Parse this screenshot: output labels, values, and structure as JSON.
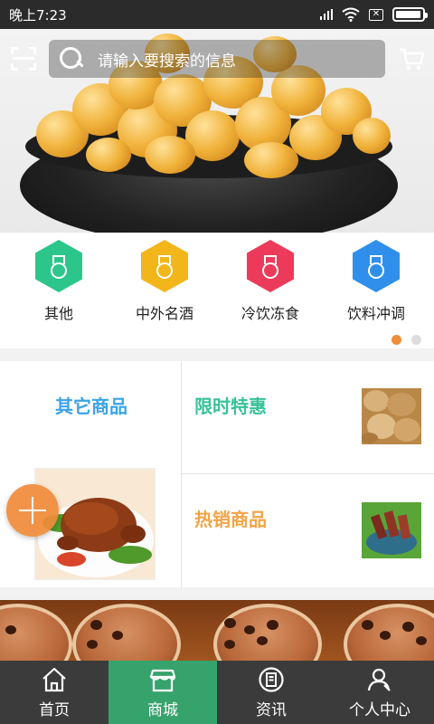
{
  "status_bar": {
    "time": "晚上7:23",
    "background": "#2b2b2b"
  },
  "search": {
    "placeholder": "请输入要搜索的信息"
  },
  "icons": {
    "scan": "scan-icon",
    "search": "search-icon",
    "cart": "cart-icon",
    "wifi": "wifi-icon",
    "battery": "battery-icon"
  },
  "battery": {
    "level": 0.95
  },
  "categories": [
    {
      "label": "其他",
      "color": "#2cc68a",
      "icon": "medal-icon"
    },
    {
      "label": "中外名酒",
      "color": "#f2b61b",
      "icon": "medal-icon"
    },
    {
      "label": "冷饮冻食",
      "color": "#ec3b5a",
      "icon": "medal-icon"
    },
    {
      "label": "饮料冲调",
      "color": "#2f8fea",
      "icon": "medal-icon"
    }
  ],
  "pager": {
    "active_color": "#f08c3a",
    "inactive_color": "#dddddd",
    "pages": 2,
    "current": 1
  },
  "promo": {
    "left_title": "其它商品",
    "left_color": "#3aa3e8",
    "top_right_title": "限时特惠",
    "top_right_color": "#37c29a",
    "bottom_right_title": "热销商品",
    "bottom_right_color": "#f2a445"
  },
  "fab": {
    "icon": "plus-icon",
    "color": "#f08c3a"
  },
  "tabbar": {
    "active_color": "#37a36c",
    "items": [
      {
        "label": "首页",
        "icon": "home-icon",
        "active": false
      },
      {
        "label": "商城",
        "icon": "store-icon",
        "active": true
      },
      {
        "label": "资讯",
        "icon": "news-icon",
        "active": false
      },
      {
        "label": "个人中心",
        "icon": "user-icon",
        "active": false
      }
    ]
  }
}
